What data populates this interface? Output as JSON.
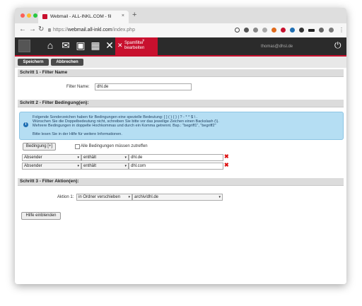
{
  "browser": {
    "tab_title": "Webmail - ALL-INKL.COM - fil",
    "tab_close": "×",
    "new_tab": "+",
    "url_prefix": "https://",
    "url_host": "webmail.all-inkl.com",
    "url_path": "/index.php"
  },
  "appbar": {
    "active_tab_line1": "Spamfilter",
    "active_tab_line2": "bearbeiten",
    "active_tab_close": "×",
    "user": "thomas@dhsl.de"
  },
  "toolbar": {
    "save_label": "Speichern",
    "cancel_label": "Abbrechen"
  },
  "step1": {
    "title": "Schritt 1 - Filter Name",
    "filter_name_label": "Filter Name:",
    "filter_name_value": "dhl.de"
  },
  "step2": {
    "title": "Schritt 2 - Filter Bedingung(en):",
    "info_lines": [
      "Folgende Sonderzeichen haben für Bedingungen eine spezielle Bedeutung: [ ] ( ) { } | ? - * ^ $ \\ .",
      "Wünschen Sie die Doppelbedeutung nicht, schreiben Sie bitte vor das jeweilige Zeichen einen Backslash (\\).",
      "Mehrere Bedingungen in doppelte Hochkommas und durch ein Komma getrennt. Bsp.: \"begriff1\", \"begriff2\"",
      "Bitte lesen Sie in der Hilfe für weitere Informationen."
    ],
    "add_condition_label": "Bedingung [+]",
    "all_conditions_label": "Alle Bedingungen müssen zutreffen",
    "conditions": [
      {
        "field": "Absender",
        "operator": "enthält",
        "value": "dhl.de"
      },
      {
        "field": "Absender",
        "operator": "enthält",
        "value": "dhl.com"
      }
    ]
  },
  "step3": {
    "title": "Schritt 3 - Filter Aktion(en):",
    "action_label": "Aktion 1:",
    "action_value": "in Ordner verschieben",
    "folder_value": "archiv/dhl.de"
  },
  "help_button_label": "Hilfe einblenden",
  "colors": {
    "accent": "#c8102e",
    "appbar": "#2b2b2b",
    "info_bg": "#b5def3"
  }
}
